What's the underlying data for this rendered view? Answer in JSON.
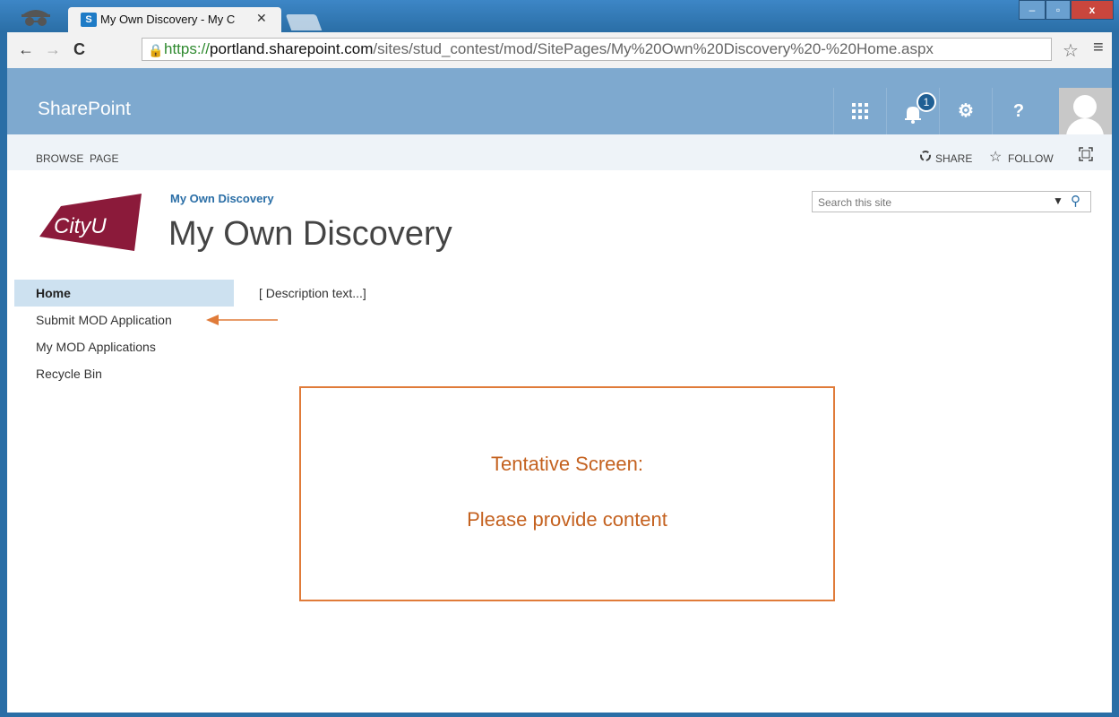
{
  "browser": {
    "tab_title": "My Own Discovery - My C",
    "tab_close": "✕",
    "url_https": "https://",
    "url_host": "portland.sharepoint.com",
    "url_path": "/sites/stud_contest/mod/SitePages/My%20Own%20Discovery%20-%20Home.aspx",
    "nav": {
      "back": "←",
      "forward": "→",
      "reload": "C"
    },
    "window_buttons": {
      "minimize": "–",
      "maximize": "▫",
      "close": "x"
    },
    "bookmark_star": "☆",
    "menu": "≡"
  },
  "suitebar": {
    "brand": "SharePoint",
    "apps_icon": "app-launcher-icon",
    "notifications_count": "1",
    "settings_icon": "gear-icon",
    "help_label": "?"
  },
  "ribbon": {
    "tabs": [
      "BROWSE",
      "PAGE"
    ],
    "share_label": "SHARE",
    "follow_label": "FOLLOW"
  },
  "site": {
    "logo_text": "CityU",
    "crumb": "My Own Discovery",
    "title": "My Own Discovery",
    "search_placeholder": "Search this site"
  },
  "nav": {
    "items": [
      {
        "label": "Home",
        "selected": true
      },
      {
        "label": "Submit MOD Application"
      },
      {
        "label": "My MOD Applications"
      },
      {
        "label": "Recycle Bin"
      }
    ]
  },
  "main": {
    "description": "[ Description text...]",
    "tentative_line1": "Tentative Screen:",
    "tentative_line2": "Please provide content"
  },
  "colors": {
    "suite_blue": "#7ea9cf",
    "annotation_orange": "#e07b39",
    "chrome_blue": "#2a6ea6"
  }
}
